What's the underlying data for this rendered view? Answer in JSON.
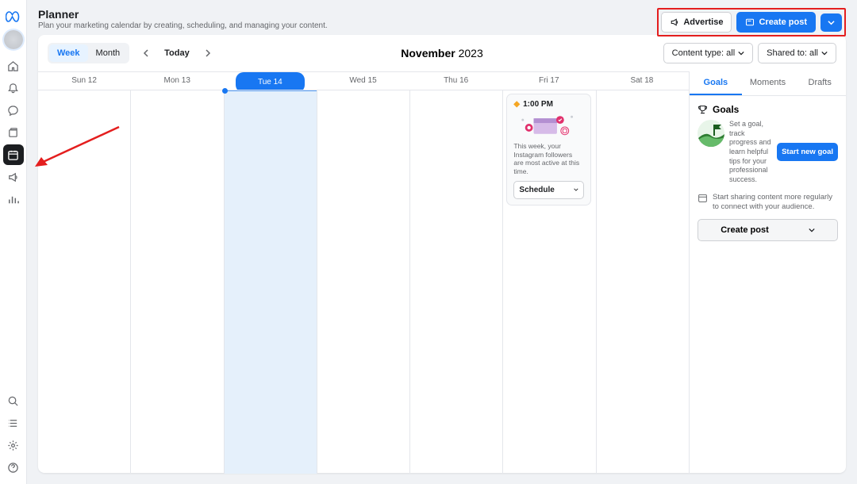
{
  "header": {
    "title": "Planner",
    "subtitle": "Plan your marketing calendar by creating, scheduling, and managing your content.",
    "advertise": "Advertise",
    "create_post": "Create post"
  },
  "toolbar": {
    "week": "Week",
    "month": "Month",
    "today": "Today",
    "month_label_bold": "November",
    "month_label_year": "2023",
    "content_type": "Content type: all",
    "shared_to": "Shared to: all"
  },
  "calendar": {
    "days": [
      {
        "label": "Sun 12"
      },
      {
        "label": "Mon 13"
      },
      {
        "label": "Tue 14",
        "active": true
      },
      {
        "label": "Wed 15"
      },
      {
        "label": "Thu 16"
      },
      {
        "label": "Fri 17"
      },
      {
        "label": "Sat 18"
      }
    ],
    "suggestion": {
      "time": "1:00 PM",
      "text": "This week, your Instagram followers are most active at this time.",
      "button": "Schedule"
    }
  },
  "right_panel": {
    "tabs": {
      "goals": "Goals",
      "moments": "Moments",
      "drafts": "Drafts"
    },
    "goals_heading": "Goals",
    "goals_text": "Set a goal, track progress and learn helpful tips for your professional success.",
    "start_goal": "Start new goal",
    "tip_text": "Start sharing content more regularly to connect with your audience.",
    "create_post": "Create post"
  },
  "sidebar": {
    "icons": [
      "home",
      "bell",
      "chat",
      "content",
      "planner",
      "ads",
      "insights",
      "search",
      "list",
      "settings",
      "help"
    ]
  }
}
